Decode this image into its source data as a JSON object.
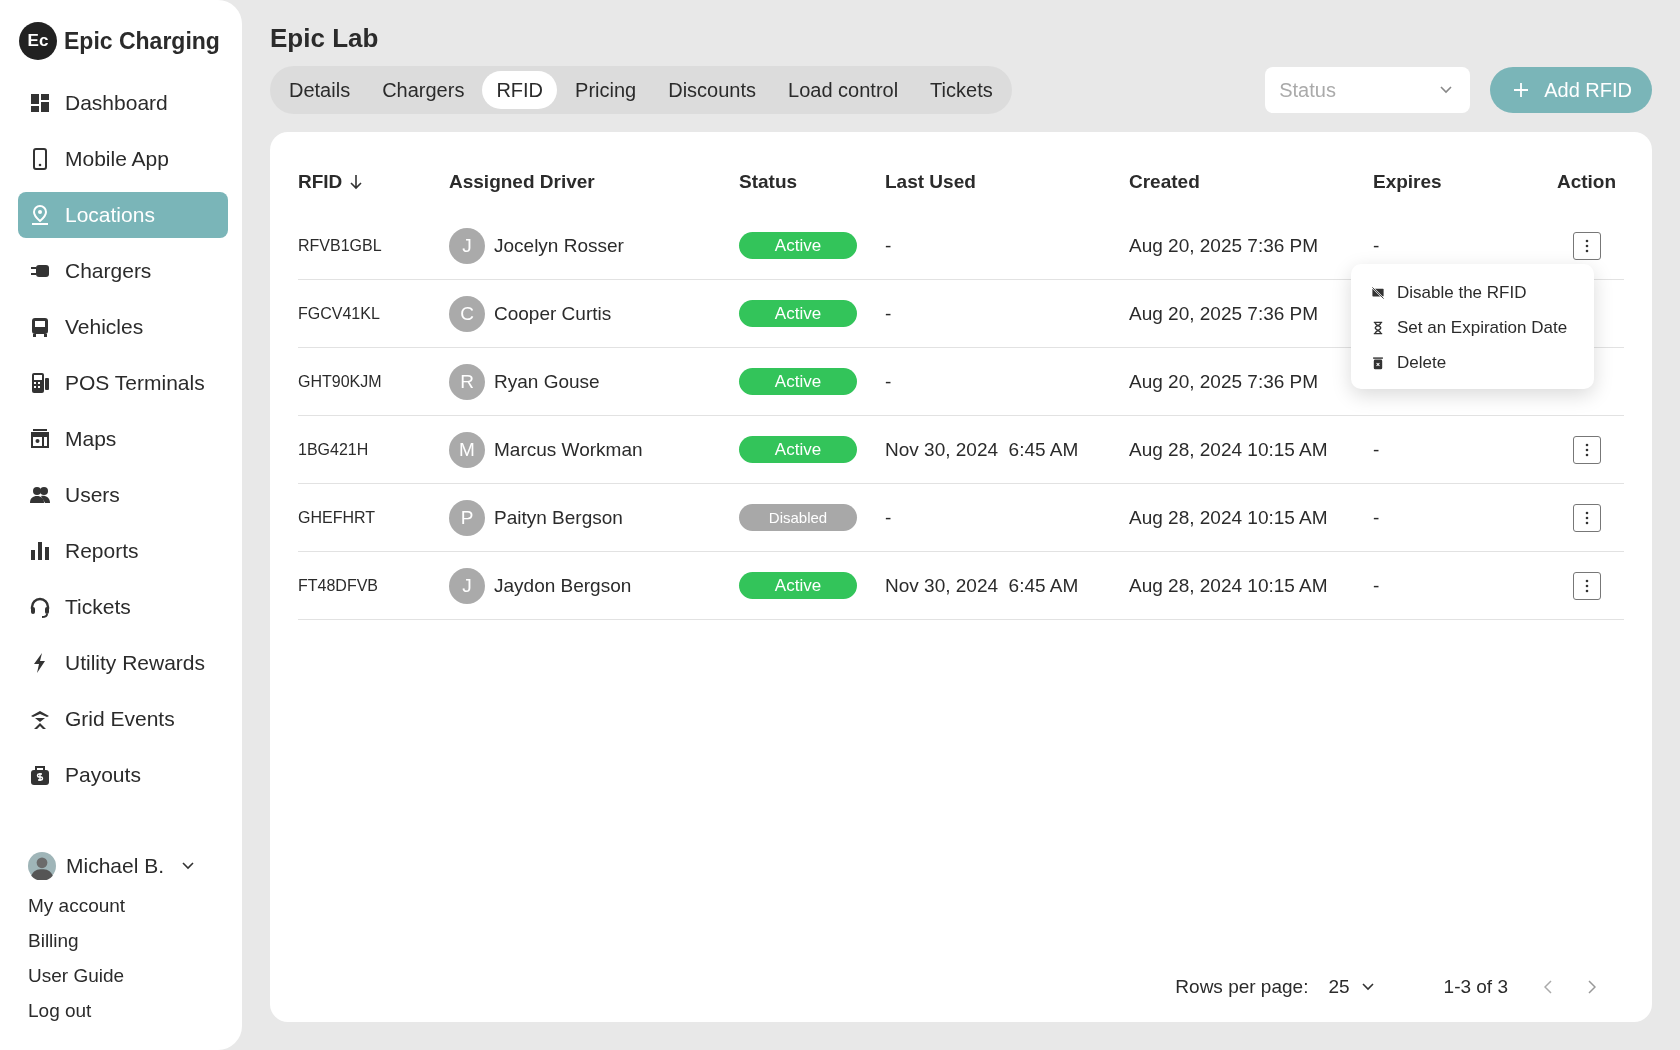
{
  "brand": {
    "logo": "Ec",
    "name": "Epic Charging"
  },
  "sidebar": {
    "items": [
      {
        "label": "Dashboard",
        "selected": false
      },
      {
        "label": "Mobile App",
        "selected": false
      },
      {
        "label": "Locations",
        "selected": true
      },
      {
        "label": "Chargers",
        "selected": false
      },
      {
        "label": "Vehicles",
        "selected": false
      },
      {
        "label": "POS Terminals",
        "selected": false
      },
      {
        "label": "Maps",
        "selected": false
      },
      {
        "label": "Users",
        "selected": false
      },
      {
        "label": "Reports",
        "selected": false
      },
      {
        "label": "Tickets",
        "selected": false
      },
      {
        "label": "Utility Rewards",
        "selected": false
      },
      {
        "label": "Grid Events",
        "selected": false
      },
      {
        "label": "Payouts",
        "selected": false
      }
    ],
    "user": {
      "name": "Michael B.",
      "links": [
        "My account",
        "Billing",
        "User Guide",
        "Log out"
      ]
    }
  },
  "page_title": "Epic Lab",
  "tabs": [
    {
      "label": "Details",
      "selected": false
    },
    {
      "label": "Chargers",
      "selected": false
    },
    {
      "label": "RFID",
      "selected": true
    },
    {
      "label": "Pricing",
      "selected": false
    },
    {
      "label": "Discounts",
      "selected": false
    },
    {
      "label": "Load control",
      "selected": false
    },
    {
      "label": "Tickets",
      "selected": false
    }
  ],
  "status_filter": {
    "placeholder": "Status"
  },
  "add_button": "Add RFID",
  "table": {
    "columns": [
      "RFID",
      "Assigned Driver",
      "Status",
      "Last Used",
      "Created",
      "Expires",
      "Action"
    ],
    "rows": [
      {
        "rfid": "RFVB1GBL",
        "initial": "J",
        "driver": "Jocelyn Rosser",
        "status": "Active",
        "kind": "active",
        "last_used": "-",
        "created": "Aug 20, 2025 7:36 PM",
        "expires": "-",
        "action_button": true
      },
      {
        "rfid": "FGCV41KL",
        "initial": "C",
        "driver": "Cooper Curtis",
        "status": "Active",
        "kind": "active",
        "last_used": "-",
        "created": "Aug 20, 2025 7:36 PM",
        "action_button": false
      },
      {
        "rfid": "GHT90KJM",
        "initial": "R",
        "driver": "Ryan Gouse",
        "status": "Active",
        "kind": "active",
        "last_used": "-",
        "created": "Aug 20, 2025 7:36 PM",
        "action_button": false
      },
      {
        "rfid": "1BG421H",
        "initial": "M",
        "driver": "Marcus Workman",
        "status": "Active",
        "kind": "active",
        "last_used": "Nov 30, 2024  6:45 AM",
        "created": "Aug 28, 2024 10:15 AM",
        "expires": "-",
        "action_button": true
      },
      {
        "rfid": "GHEFHRT",
        "initial": "P",
        "driver": "Paityn Bergson",
        "status": "Disabled",
        "kind": "disabled",
        "last_used": "-",
        "created": "Aug 28, 2024 10:15 AM",
        "expires": "-",
        "action_button": true
      },
      {
        "rfid": "FT48DFVB",
        "initial": "J",
        "driver": "Jaydon Bergson",
        "status": "Active",
        "kind": "active",
        "last_used": "Nov 30, 2024  6:45 AM",
        "created": "Aug 28, 2024 10:15 AM",
        "expires": "-",
        "action_button": true
      }
    ]
  },
  "row_menu": {
    "items": [
      {
        "label": "Disable the RFID",
        "kind": "disable"
      },
      {
        "label": "Set an Expiration Date",
        "kind": "expire"
      },
      {
        "label": "Delete",
        "kind": "delete"
      }
    ]
  },
  "pagination": {
    "rows_label": "Rows per page:",
    "rows_value": "25",
    "range": "1-3 of 3"
  }
}
